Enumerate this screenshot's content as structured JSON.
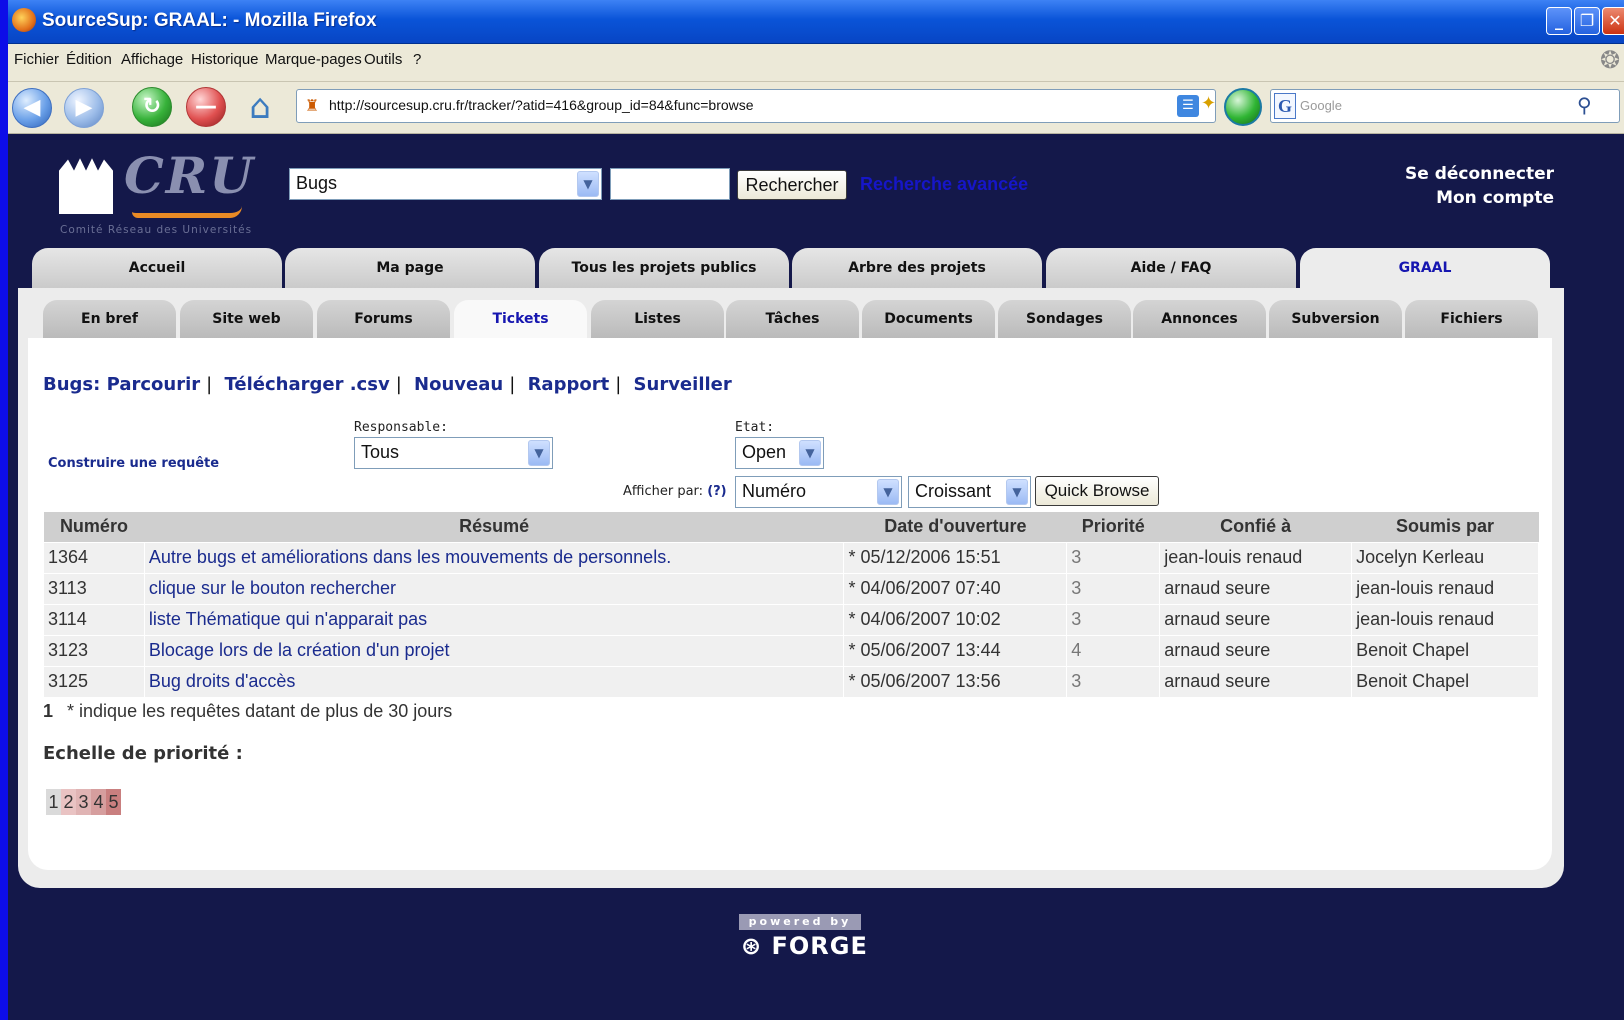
{
  "window": {
    "title": "SourceSup: GRAAL: - Mozilla Firefox"
  },
  "menu": [
    "Fichier",
    "Édition",
    "Affichage",
    "Historique",
    "Marque-pages",
    "Outils",
    "?"
  ],
  "browser": {
    "url": "http://sourcesup.cru.fr/tracker/?atid=416&group_id=84&func=browse",
    "search_placeholder": "Google"
  },
  "header": {
    "logo_word": "CRU",
    "logo_sub": "Comité Réseau des Universités",
    "search_type": "Bugs",
    "search_value": "",
    "search_button": "Rechercher",
    "advanced_search": "Recherche avancée",
    "logout": "Se déconnecter",
    "account": "Mon compte"
  },
  "main_tabs": [
    "Accueil",
    "Ma page",
    "Tous les projets publics",
    "Arbre des projets",
    "Aide / FAQ",
    "GRAAL"
  ],
  "sub_tabs": [
    "En bref",
    "Site web",
    "Forums",
    "Tickets",
    "Listes",
    "Tâches",
    "Documents",
    "Sondages",
    "Annonces",
    "Subversion",
    "Fichiers"
  ],
  "actions": {
    "prefix": "Bugs:",
    "items": [
      "Parcourir",
      "Télécharger .csv",
      "Nouveau",
      "Rapport",
      "Surveiller"
    ]
  },
  "filters": {
    "build_query": "Construire une requête",
    "responsable_label": "Responsable:",
    "responsable_value": "Tous",
    "etat_label": "Etat:",
    "etat_value": "Open",
    "sort_label": "Afficher par:",
    "sort_help": "(?)",
    "sort_field": "Numéro",
    "sort_order": "Croissant",
    "quick_browse": "Quick Browse"
  },
  "table": {
    "headers": [
      "Numéro",
      "Résumé",
      "Date d'ouverture",
      "Priorité",
      "Confié à",
      "Soumis par"
    ],
    "rows": [
      {
        "id": "1364",
        "summary": "Autre bugs et améliorations dans les mouvements de personnels.",
        "date": "* 05/12/2006 15:51",
        "priority": "3",
        "assigned": "jean-louis renaud",
        "submitter": "Jocelyn Kerleau"
      },
      {
        "id": "3113",
        "summary": "clique sur le bouton rechercher",
        "date": "* 04/06/2007 07:40",
        "priority": "3",
        "assigned": "arnaud seure",
        "submitter": "jean-louis renaud"
      },
      {
        "id": "3114",
        "summary": "liste Thématique qui n'apparait pas",
        "date": "* 04/06/2007 10:02",
        "priority": "3",
        "assigned": "arnaud seure",
        "submitter": "jean-louis renaud"
      },
      {
        "id": "3123",
        "summary": "Blocage lors de la création d'un projet",
        "date": "* 05/06/2007 13:44",
        "priority": "4",
        "assigned": "arnaud seure",
        "submitter": "Benoit Chapel"
      },
      {
        "id": "3125",
        "summary": "Bug droits d'accès",
        "date": "* 05/06/2007 13:56",
        "priority": "3",
        "assigned": "arnaud seure",
        "submitter": "Benoit Chapel"
      }
    ]
  },
  "footnote": {
    "num": "1",
    "text": "* indique les requêtes datant de plus de 30 jours"
  },
  "priority_scale": {
    "title": "Echelle de priorité :",
    "levels": [
      "1",
      "2",
      "3",
      "4",
      "5"
    ],
    "colors": [
      "#dadada",
      "#e9c3c3",
      "#e0b4b4",
      "#d69e9e",
      "#c97f7f"
    ]
  },
  "footer": {
    "powered": "powered by",
    "forge": "FORGE"
  }
}
